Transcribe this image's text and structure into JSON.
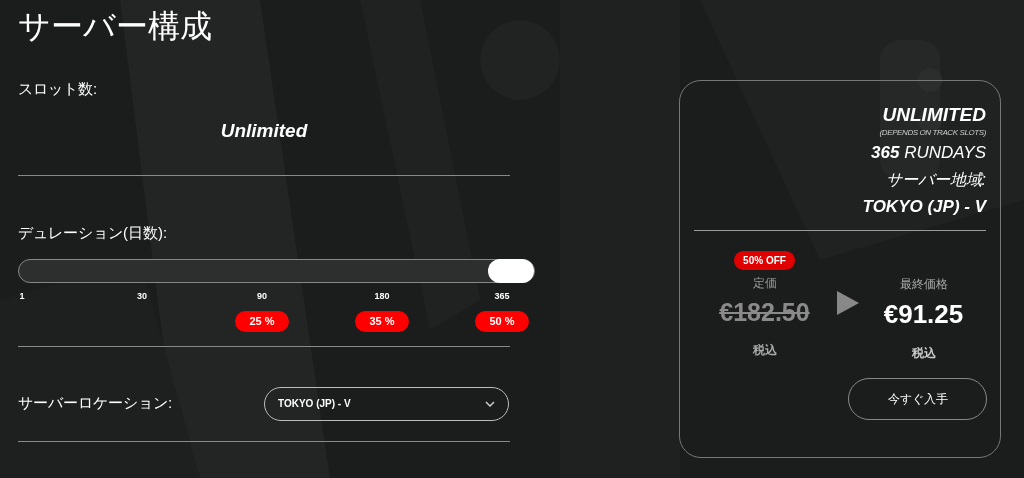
{
  "title": "サーバー構成",
  "slots": {
    "label": "スロット数:",
    "value": "Unlimited"
  },
  "duration": {
    "label": "デュレーション(日数):",
    "level": 1,
    "ticks": [
      {
        "label": "1"
      },
      {
        "label": "30"
      },
      {
        "label": "90",
        "discount": "25 %"
      },
      {
        "label": "180",
        "discount": "35 %"
      },
      {
        "label": "365",
        "discount": "50 %"
      }
    ]
  },
  "location": {
    "label": "サーバーロケーション:",
    "value": "TOKYO (JP) - V"
  },
  "summary": {
    "slots": "UNLIMITED",
    "slots_note": "(DEPENDS ON TRACK SLOTS)",
    "days": "365",
    "days_unit": "RUNDAYS",
    "region_label": "サーバー地域:",
    "region": "TOKYO (JP) - V",
    "badge": "50% OFF",
    "list_label": "定価",
    "list_price": "€182.50",
    "list_tax": "税込",
    "final_label": "最終価格",
    "final_price": "€91.25",
    "final_tax": "税込",
    "button": "今すぐ入手"
  }
}
